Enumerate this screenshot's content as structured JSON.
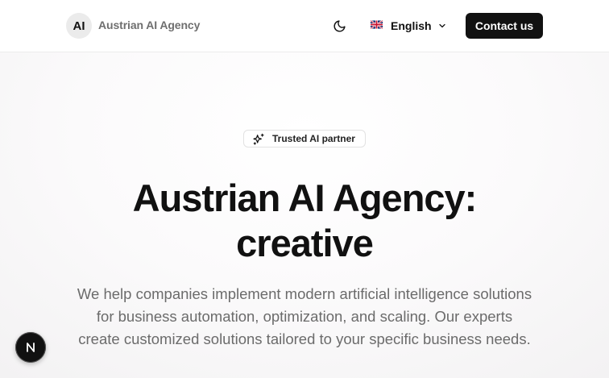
{
  "header": {
    "logo_text": "AI",
    "brand_name": "Austrian AI Agency",
    "language": "English",
    "contact_label": "Contact us"
  },
  "hero": {
    "badge": "Trusted AI partner",
    "title_line1": "Austrian AI Agency:",
    "title_line2": "creative",
    "description_lines": [
      "We help companies implement modern artificial intelligence solutions",
      "for business automation, optimization, and scaling. Our experts",
      "create customized solutions tailored to your specific business needs."
    ]
  },
  "dev_badge": {
    "logo_letter": "N"
  },
  "icons": {
    "theme": "moon-icon",
    "flag": "uk-flag-icon",
    "dropdown": "chevron-down-icon",
    "badge": "sparkles-icon",
    "dev": "nextjs-logo-icon"
  },
  "colors": {
    "primary": "#111111",
    "muted_text": "#6b6b6b",
    "brand_text": "#6f6f6f",
    "logo_bg": "#ebebeb"
  }
}
